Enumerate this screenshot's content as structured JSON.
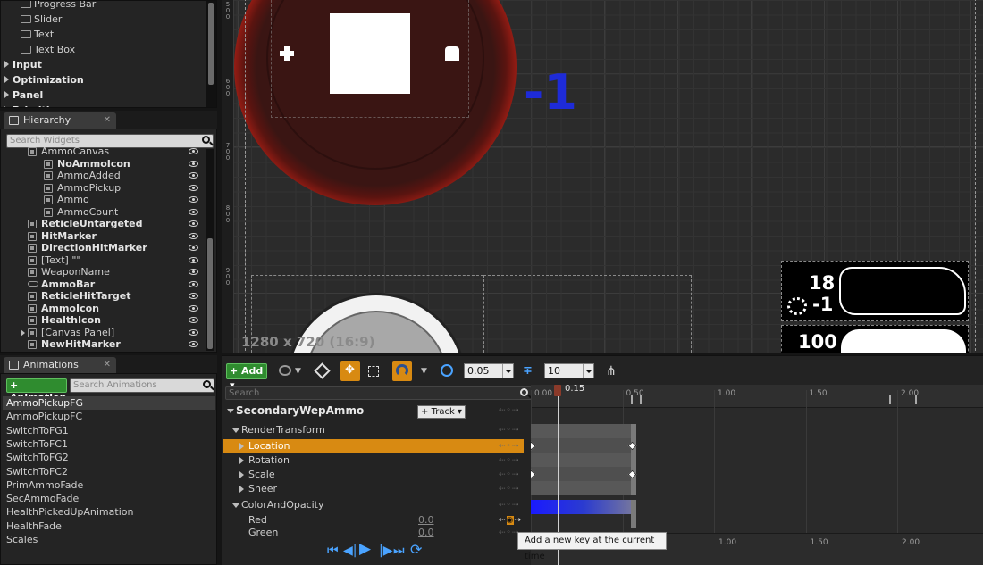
{
  "palette": {
    "items": [
      {
        "label": "Progress Bar",
        "type": "item"
      },
      {
        "label": "Slider",
        "type": "item"
      },
      {
        "label": "Text",
        "type": "item"
      },
      {
        "label": "Text Box",
        "type": "item"
      },
      {
        "label": "Input",
        "type": "category"
      },
      {
        "label": "Optimization",
        "type": "category"
      },
      {
        "label": "Panel",
        "type": "category"
      },
      {
        "label": "Primitive",
        "type": "category"
      }
    ]
  },
  "hierarchy": {
    "tab_label": "Hierarchy",
    "search_placeholder": "Search Widgets",
    "rows": [
      {
        "label": "AmmoCanvas",
        "indent": 2,
        "bold": false
      },
      {
        "label": "NoAmmoIcon",
        "indent": 3,
        "bold": true
      },
      {
        "label": "AmmoAdded",
        "indent": 3,
        "bold": false
      },
      {
        "label": "AmmoPickup",
        "indent": 3,
        "bold": false
      },
      {
        "label": "Ammo",
        "indent": 3,
        "bold": false
      },
      {
        "label": "AmmoCount",
        "indent": 3,
        "bold": false
      },
      {
        "label": "ReticleUntargeted",
        "indent": 2,
        "bold": true
      },
      {
        "label": "HitMarker",
        "indent": 2,
        "bold": true
      },
      {
        "label": "DirectionHitMarker",
        "indent": 2,
        "bold": true
      },
      {
        "label": "[Text] \"\"",
        "indent": 2,
        "bold": false
      },
      {
        "label": "WeaponName",
        "indent": 2,
        "bold": false
      },
      {
        "label": "AmmoBar",
        "indent": 2,
        "bold": true
      },
      {
        "label": "ReticleHitTarget",
        "indent": 2,
        "bold": true
      },
      {
        "label": "AmmoIcon",
        "indent": 2,
        "bold": true
      },
      {
        "label": "HealthIcon",
        "indent": 2,
        "bold": true
      },
      {
        "label": "[Canvas Panel]",
        "indent": 2,
        "bold": false
      },
      {
        "label": "NewHitMarker",
        "indent": 2,
        "bold": true
      }
    ]
  },
  "animations": {
    "tab_label": "Animations",
    "add_label": "+ Animation",
    "search_placeholder": "Search Animations",
    "items": [
      "AmmoPickupFG",
      "AmmoPickupFC",
      "SwitchToFG1",
      "SwitchToFC1",
      "SwitchToFG2",
      "SwitchToFC2",
      "PrimAmmoFade",
      "SecAmmoFade",
      "HealthPickedUpAnimation",
      "HealthFade",
      "Scales"
    ],
    "selected": "AmmoPickupFG"
  },
  "viewport": {
    "ruler_labels": [
      "5\n0\n0",
      "6\n0\n0",
      "7\n0\n0",
      "8\n0\n0",
      "9\n0\n0"
    ],
    "minus_one": "-1",
    "resolution_label": "1280 x 720 (16:9)",
    "hud_ammo_count": "18",
    "hud_ammo_delta": "-1",
    "hud_health": "100"
  },
  "sequencer": {
    "add_label": "Add",
    "snap_value": "0.05",
    "frame_value": "10",
    "search_placeholder": "Search",
    "animation_name": "SecondaryWepAmmo",
    "track_label": "Track",
    "current_time": "0.15",
    "ticks": [
      "0.00",
      "0.50",
      "1.00",
      "1.50",
      "2.00"
    ],
    "tracks": [
      {
        "label": "RenderTransform",
        "level": 1,
        "expanded": true
      },
      {
        "label": "Location",
        "level": 2,
        "selected": true
      },
      {
        "label": "Rotation",
        "level": 2
      },
      {
        "label": "Scale",
        "level": 2
      },
      {
        "label": "Sheer",
        "level": 2
      },
      {
        "label": "ColorAndOpacity",
        "level": 1,
        "expanded": true
      },
      {
        "label": "Red",
        "level": 2,
        "value": "0.0"
      },
      {
        "label": "Green",
        "level": 2,
        "value": "0.0"
      }
    ],
    "tooltip": "Add a new key at the current time",
    "bottom_ticks": [
      "1.00",
      "1.50",
      "2.00"
    ]
  },
  "colors": {
    "accent_orange": "#d88a12",
    "add_green": "#2f8c2f",
    "blue_text": "#1e2bd8"
  }
}
